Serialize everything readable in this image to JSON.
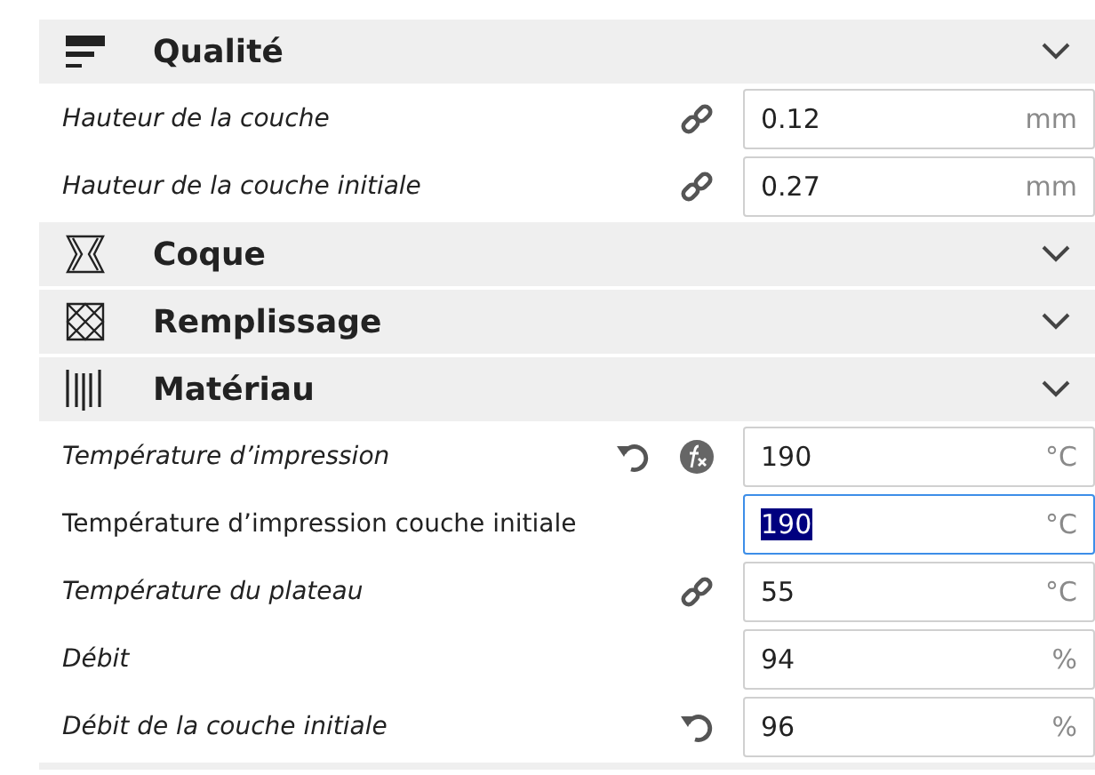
{
  "sections": [
    {
      "title": "Qualité",
      "kind": "quality",
      "settings": [
        {
          "label": "Hauteur de la couche",
          "modified": true,
          "resettable": false,
          "linked": true,
          "formula": false,
          "value": "0.12",
          "unit": "mm",
          "focused": false
        },
        {
          "label": "Hauteur de la couche initiale",
          "modified": true,
          "resettable": false,
          "linked": true,
          "formula": false,
          "value": "0.27",
          "unit": "mm",
          "focused": false
        }
      ]
    },
    {
      "title": "Coque",
      "kind": "shell"
    },
    {
      "title": "Remplissage",
      "kind": "infill"
    },
    {
      "title": "Matériau",
      "kind": "material",
      "settings": [
        {
          "label": "Température d’impression",
          "modified": true,
          "resettable": true,
          "linked": false,
          "formula": true,
          "value": "190",
          "unit": "°C",
          "focused": false
        },
        {
          "label": "Température d’impression couche initiale",
          "modified": false,
          "resettable": false,
          "linked": false,
          "formula": false,
          "value": "190",
          "unit": "°C",
          "focused": true
        },
        {
          "label": "Température du plateau",
          "modified": true,
          "resettable": false,
          "linked": true,
          "formula": false,
          "value": "55",
          "unit": "°C",
          "focused": false
        },
        {
          "label": "Débit",
          "modified": true,
          "resettable": false,
          "linked": false,
          "formula": false,
          "value": "94",
          "unit": "%",
          "focused": false
        },
        {
          "label": "Débit de la couche initiale",
          "modified": true,
          "resettable": true,
          "linked": false,
          "formula": false,
          "value": "96",
          "unit": "%",
          "focused": false
        }
      ]
    }
  ]
}
